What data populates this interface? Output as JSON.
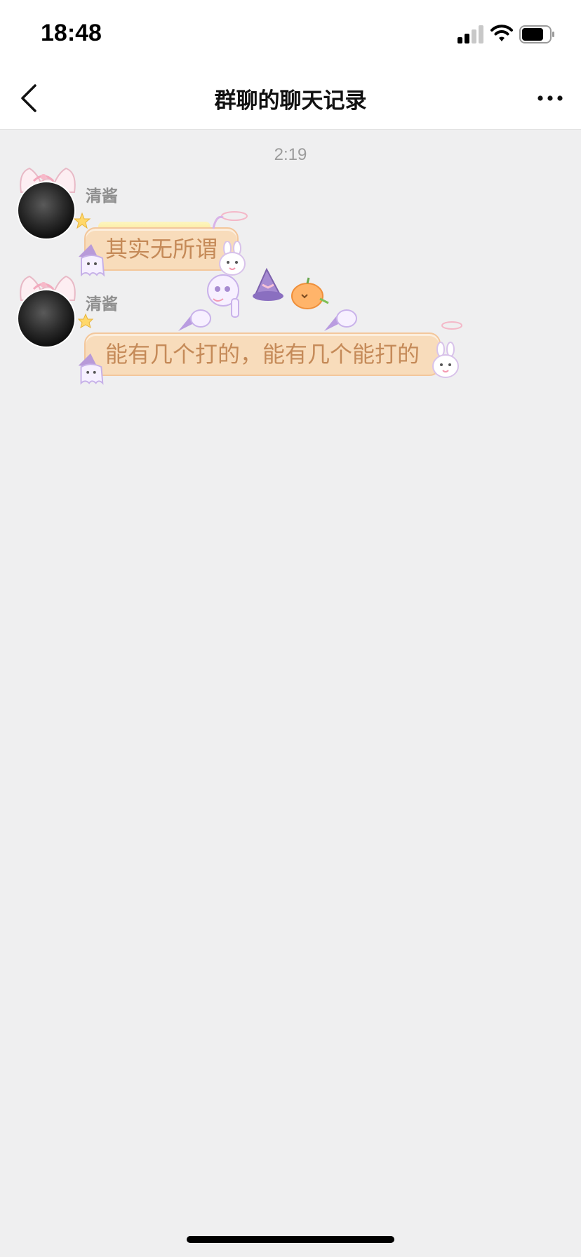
{
  "status_bar": {
    "time": "18:48"
  },
  "nav": {
    "title": "群聊的聊天记录"
  },
  "chat": {
    "time_divider": "2:19",
    "messages": [
      {
        "sender": "清酱",
        "text": "其实无所谓"
      },
      {
        "sender": "清酱",
        "text": "能有几个打的，能有几个能打的"
      }
    ]
  },
  "icons": {
    "back": "chevron-left-icon",
    "more": "ellipsis-icon",
    "signal": "cellular-signal-icon",
    "wifi": "wifi-icon",
    "battery": "battery-icon"
  },
  "colors": {
    "bubble_background": "#f8dcbb",
    "bubble_text": "#c58a58",
    "chat_background": "#efeff0",
    "sender_name": "#8f8f8f"
  }
}
